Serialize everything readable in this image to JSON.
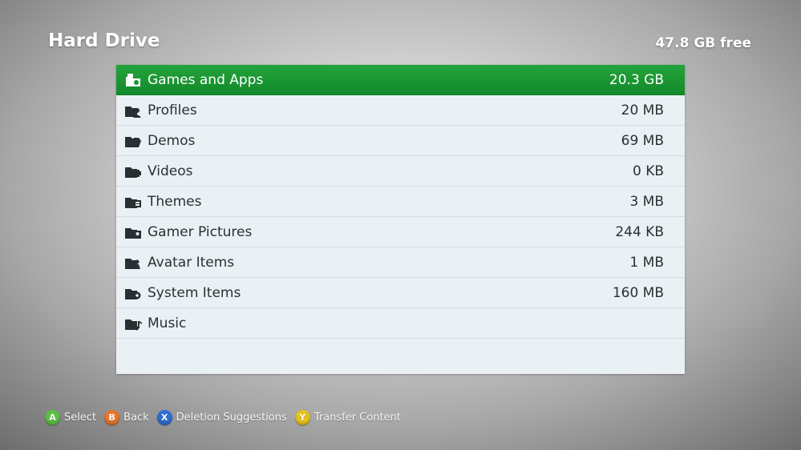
{
  "header": {
    "title": "Hard Drive",
    "free_space": "47.8 GB free"
  },
  "colors": {
    "selection": "#1a9632",
    "button_a": "#5cc045",
    "button_b": "#e8772a",
    "button_x": "#2f6fd6",
    "button_y": "#e9c41e"
  },
  "list": {
    "items": [
      {
        "label": "Games and Apps",
        "size": "20.3 GB",
        "icon": "games-and-apps-icon",
        "selected": true
      },
      {
        "label": "Profiles",
        "size": "20 MB",
        "icon": "profiles-icon"
      },
      {
        "label": "Demos",
        "size": "69 MB",
        "icon": "demos-icon"
      },
      {
        "label": "Videos",
        "size": "0 KB",
        "icon": "videos-icon"
      },
      {
        "label": "Themes",
        "size": "3 MB",
        "icon": "themes-icon"
      },
      {
        "label": "Gamer Pictures",
        "size": "244 KB",
        "icon": "gamer-pictures-icon"
      },
      {
        "label": "Avatar Items",
        "size": "1 MB",
        "icon": "avatar-items-icon"
      },
      {
        "label": "System Items",
        "size": "160 MB",
        "icon": "system-items-icon"
      },
      {
        "label": "Music",
        "size": "",
        "icon": "music-icon"
      }
    ]
  },
  "footer": {
    "a": {
      "glyph": "A",
      "label": "Select"
    },
    "b": {
      "glyph": "B",
      "label": "Back"
    },
    "x": {
      "glyph": "X",
      "label": "Deletion Suggestions"
    },
    "y": {
      "glyph": "Y",
      "label": "Transfer Content"
    }
  }
}
